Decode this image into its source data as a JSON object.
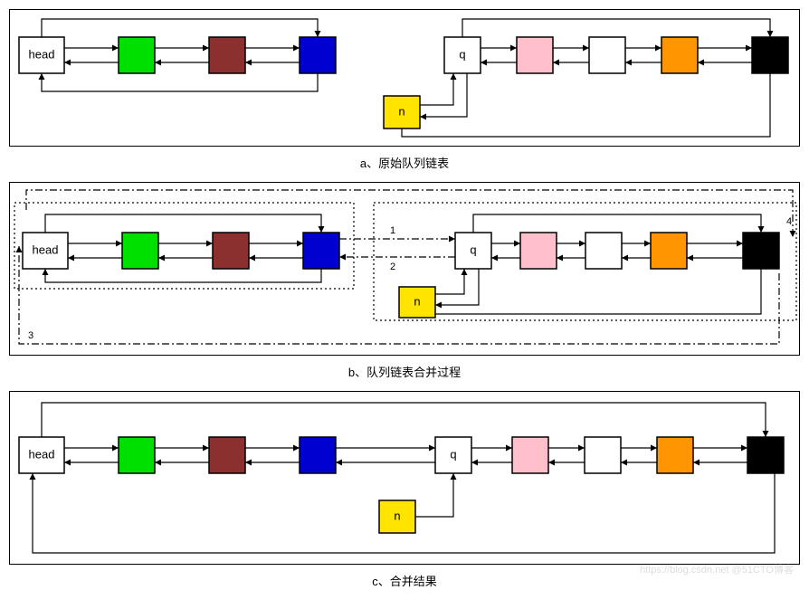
{
  "captions": {
    "a": "a、原始队列链表",
    "b": "b、队列链表合并过程",
    "c": "c、合并结果"
  },
  "nodes": {
    "head": "head",
    "q": "q",
    "n": "n"
  },
  "colors": {
    "head": "#ffffff",
    "green": "#00e000",
    "brown": "#8b2f2f",
    "blue": "#0000d0",
    "yellow": "#ffe400",
    "q": "#ffffff",
    "pink": "#ffc0cb",
    "white": "#ffffff",
    "orange": "#ff9500",
    "black": "#000000"
  },
  "edge_labels": {
    "one": "1",
    "two": "2",
    "three": "3",
    "four": "4"
  },
  "watermark": "https://blog.csdn.net @51CTO博客"
}
